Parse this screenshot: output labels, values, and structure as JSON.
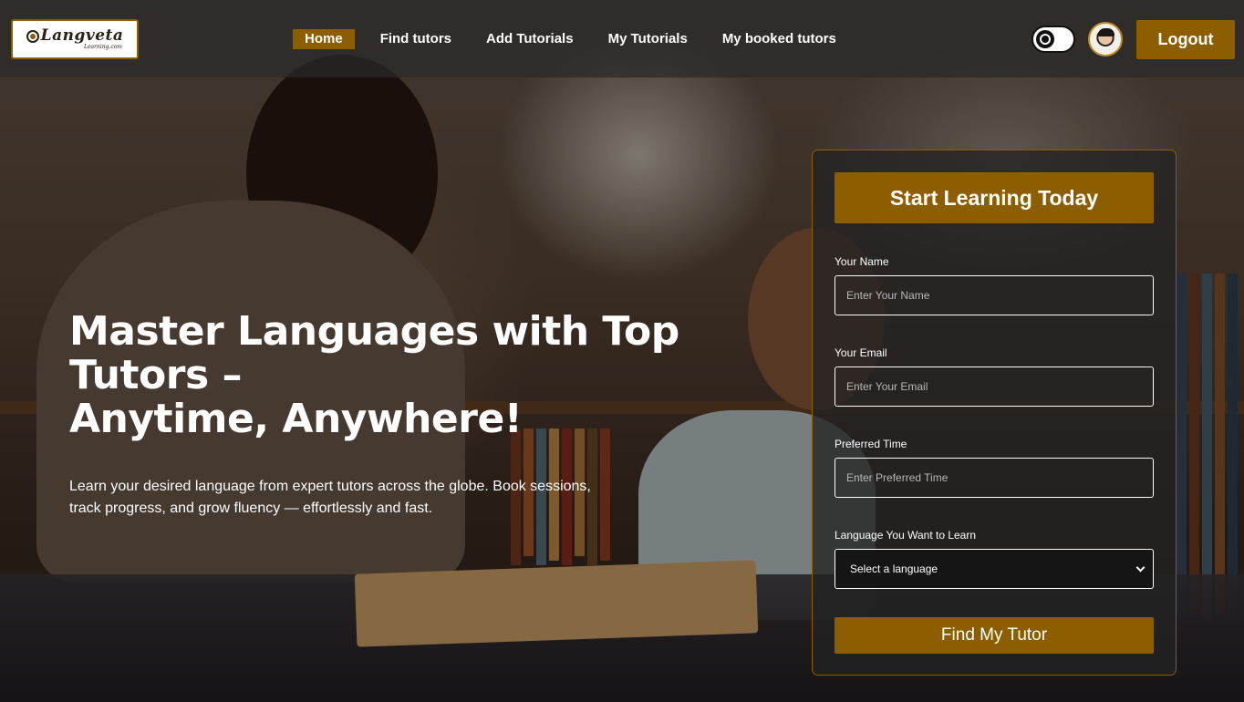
{
  "nav": {
    "logo_text": "Langveta",
    "logo_subtext": "Learning.com",
    "links": [
      {
        "label": "Home",
        "active": true
      },
      {
        "label": "Find tutors",
        "active": false
      },
      {
        "label": "Add Tutorials",
        "active": false
      },
      {
        "label": "My Tutorials",
        "active": false
      },
      {
        "label": "My booked tutors",
        "active": false
      }
    ],
    "theme_toggle_icon": "theme-toggle-icon",
    "avatar_icon": "user-avatar",
    "logout_label": "Logout"
  },
  "hero": {
    "title_line1": "Master Languages with Top Tutors –",
    "title_line2": "Anytime, Anywhere!",
    "description": "Learn your desired language from expert tutors across the globe. Book sessions, track progress, and grow fluency — effortlessly and fast."
  },
  "form": {
    "heading": "Start Learning Today",
    "name_label": "Your Name",
    "name_placeholder": "Enter Your Name",
    "email_label": "Your Email",
    "email_placeholder": "Enter Your Email",
    "time_label": "Preferred Time",
    "time_placeholder": "Enter Preferred Time",
    "language_label": "Language You Want to Learn",
    "language_selected": "Select a language",
    "submit_label": "Find My Tutor"
  },
  "colors": {
    "accent": "#8d5e00",
    "navbar_bg": "#282828",
    "card_bg": "#232323"
  }
}
